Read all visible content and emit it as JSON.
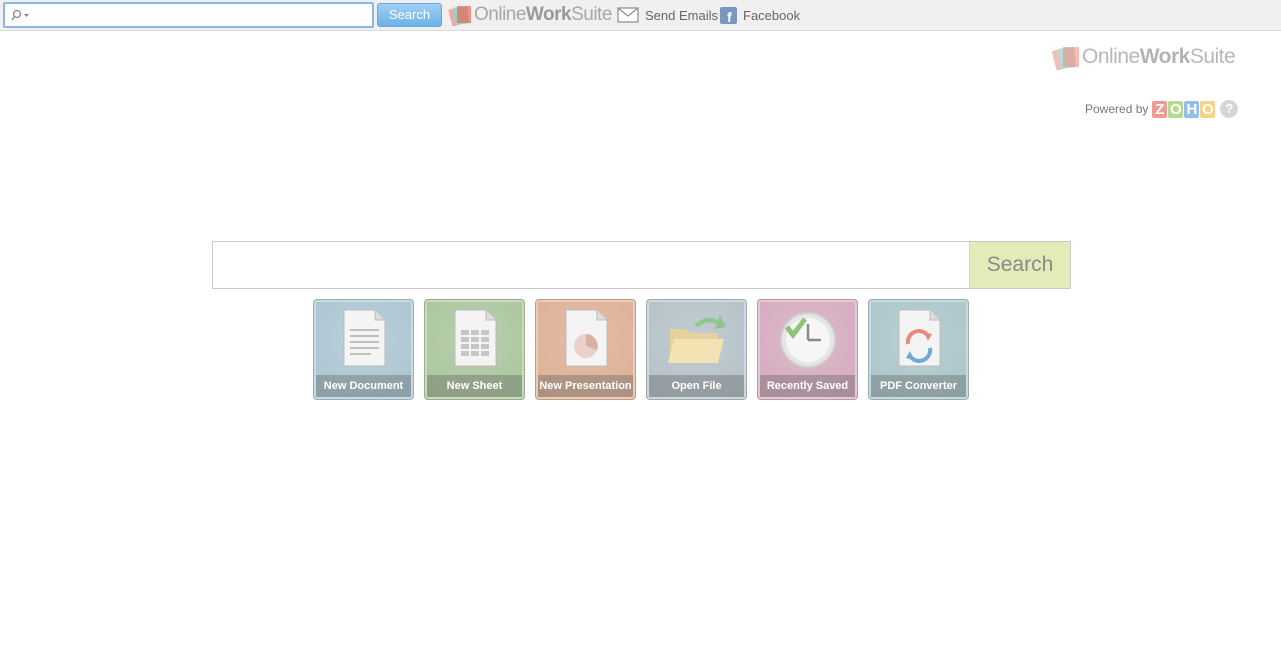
{
  "toolbar": {
    "search_value": "",
    "search_button": "Search",
    "logo_part1": "Online",
    "logo_part2": "Work",
    "logo_part3": "Suite",
    "links": [
      {
        "label": "Send Emails",
        "icon": "envelope-icon"
      },
      {
        "label": "Facebook",
        "icon": "facebook-icon"
      }
    ]
  },
  "branding": {
    "logo_part1": "Online",
    "logo_part2": "Work",
    "logo_part3": "Suite",
    "powered_by": "Powered by",
    "zoho_letters": [
      "Z",
      "O",
      "H",
      "O"
    ],
    "zoho_colors": [
      "#e04a3c",
      "#7cbc3a",
      "#3a8ad8",
      "#f0b020"
    ],
    "help": "?"
  },
  "main_search": {
    "value": "",
    "button": "Search"
  },
  "tiles": [
    {
      "label": "New Document",
      "color": "#a9c4d0",
      "icon": "document-icon"
    },
    {
      "label": "New Sheet",
      "color": "#a8c49a",
      "icon": "spreadsheet-icon"
    },
    {
      "label": "New Presentation",
      "color": "#dcae92",
      "icon": "presentation-icon"
    },
    {
      "label": "Open File",
      "color": "#b2c0c6",
      "icon": "folder-icon"
    },
    {
      "label": "Recently Saved",
      "color": "#d3a9bd",
      "icon": "clock-icon"
    },
    {
      "label": "PDF Converter",
      "color": "#a9c4c8",
      "icon": "pdf-convert-icon"
    }
  ]
}
